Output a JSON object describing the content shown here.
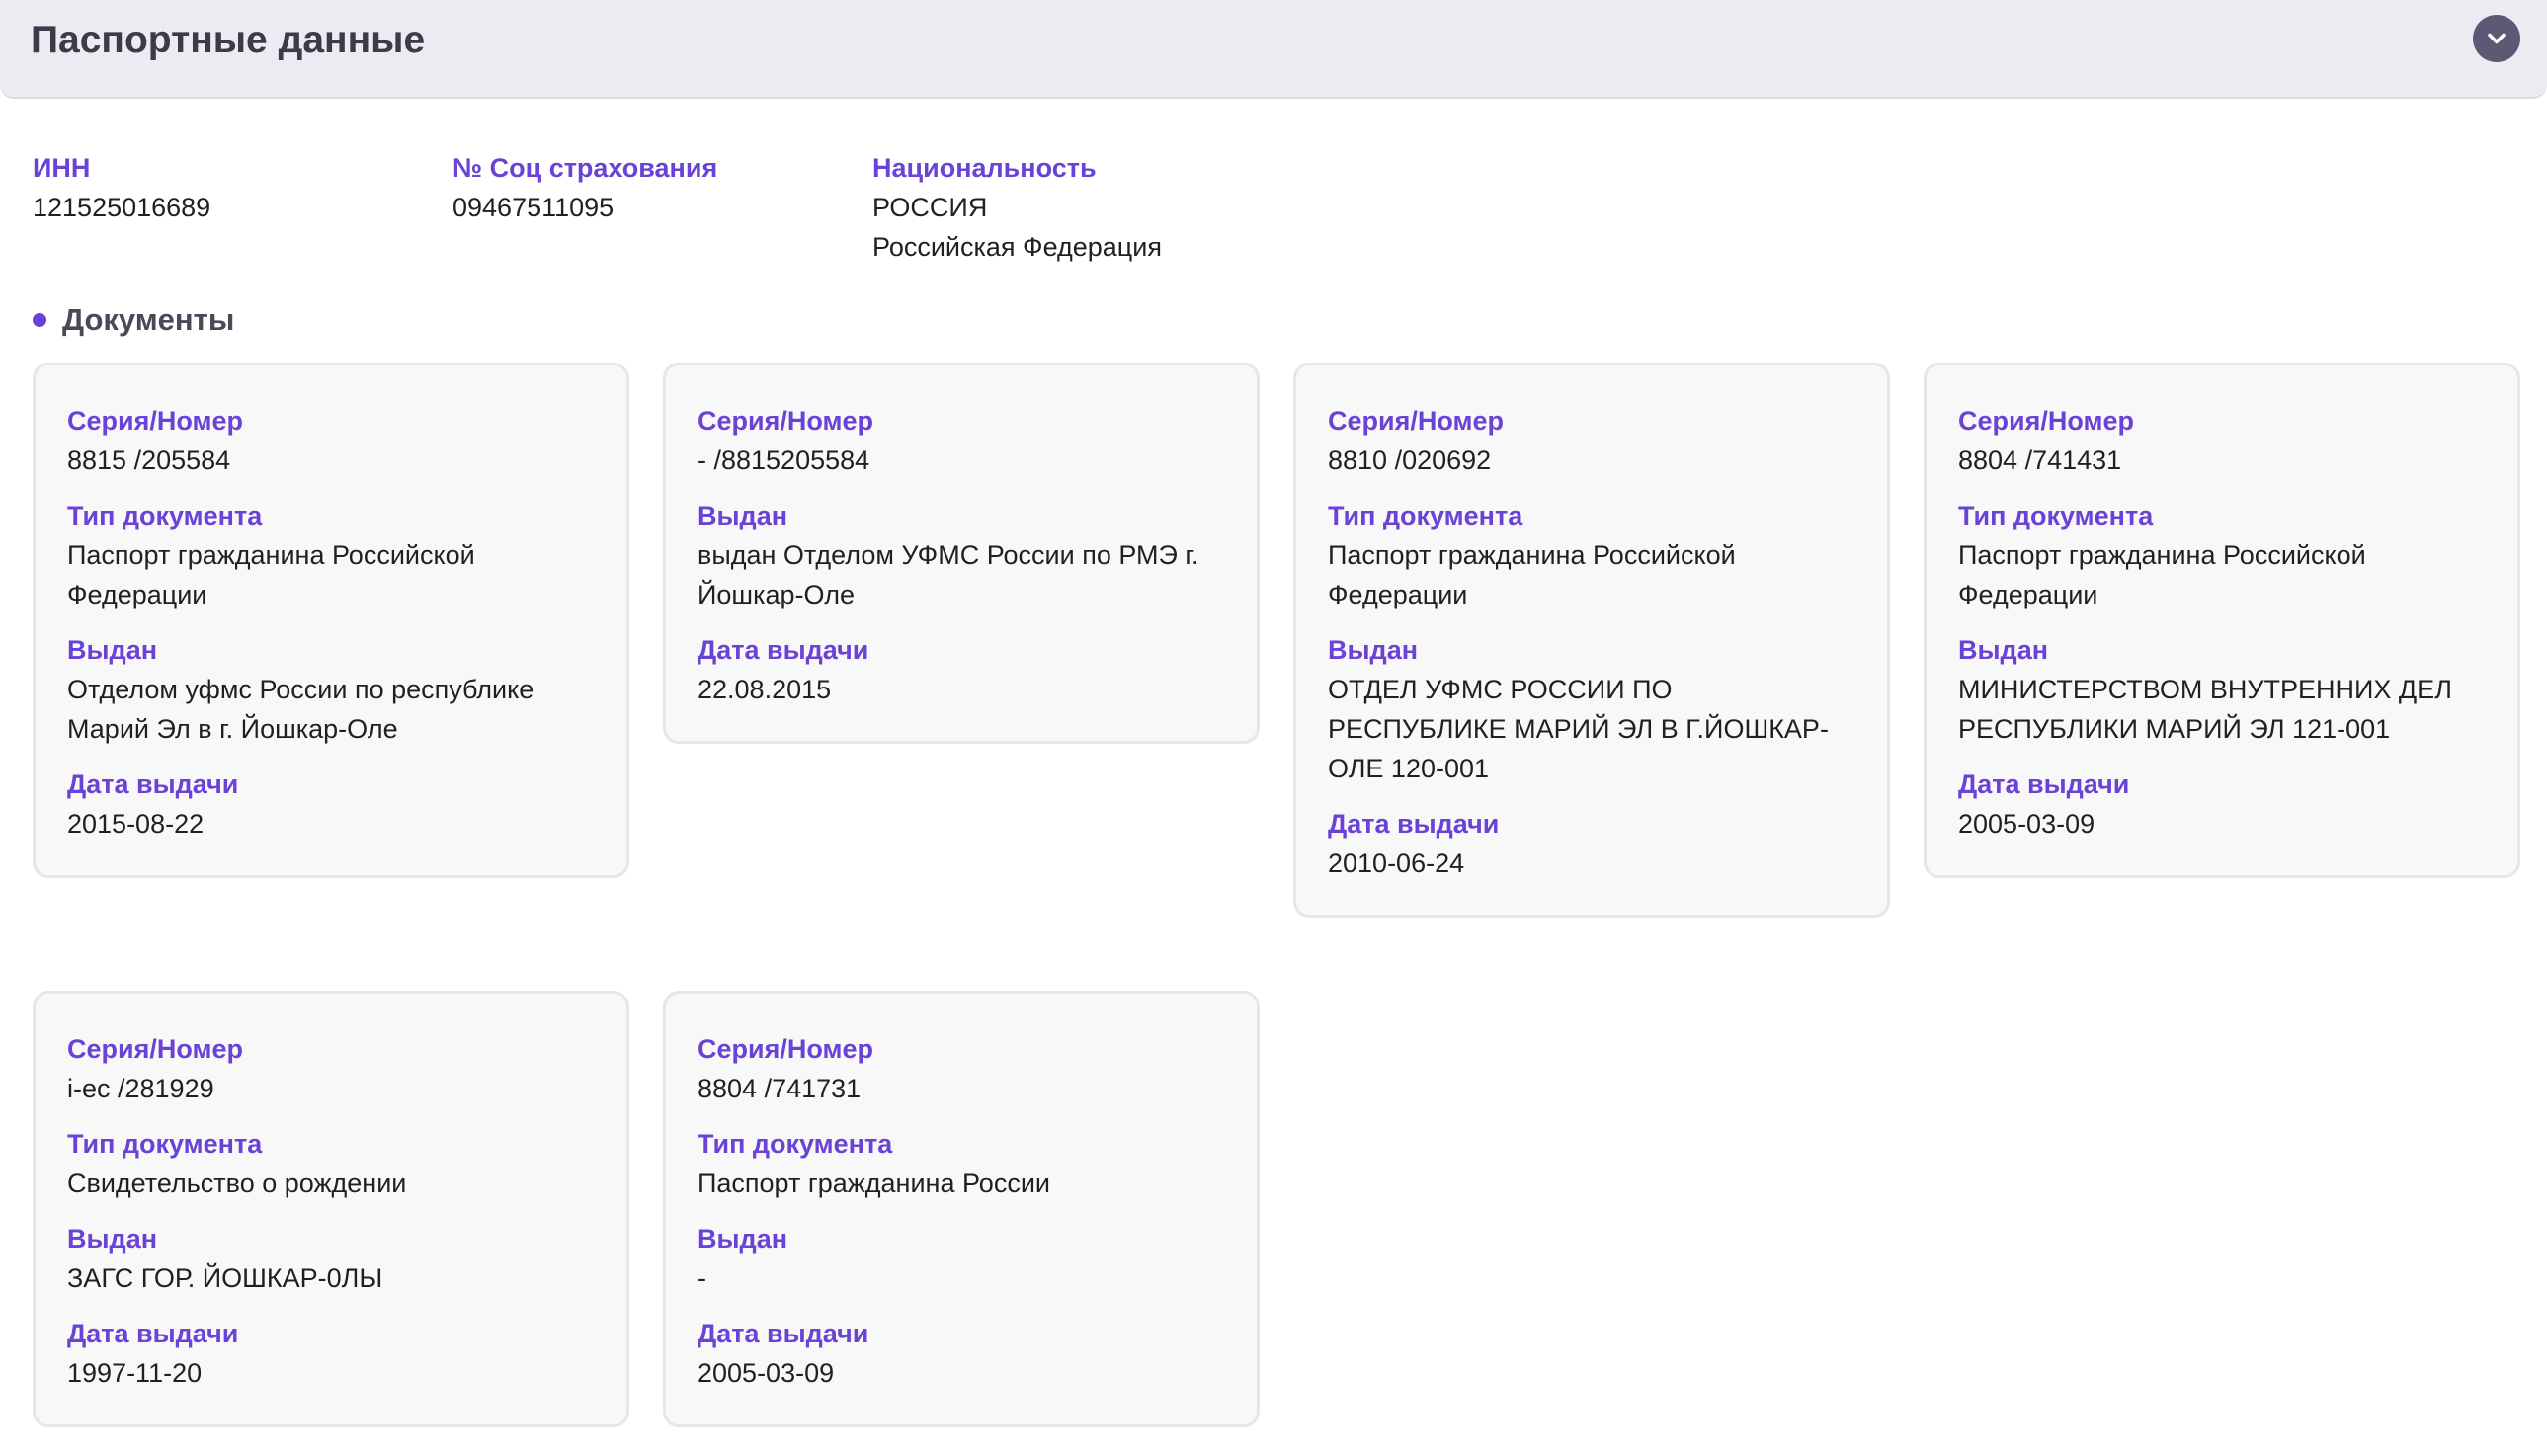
{
  "header": {
    "title": "Паспортные данные",
    "collapse_icon": "chevron-down-icon"
  },
  "summary": {
    "inn_label": "ИНН",
    "inn_value": "121525016689",
    "snils_label": "№ Соц страхования",
    "snils_value": "09467511095",
    "nationality_label": "Национальность",
    "nationality_value_1": "РОССИЯ",
    "nationality_value_2": "Российская Федерация"
  },
  "documents": {
    "title": "Документы",
    "cards": [
      {
        "series_label": "Серия/Номер",
        "series_value": "8815 /205584",
        "type_label": "Тип документа",
        "type_value": "Паспорт гражданина Российской Федерации",
        "issued_by_label": "Выдан",
        "issued_by_value": "Отделом уфмс России по республике Марий Эл в г. Йошкар-Оле",
        "date_label": "Дата выдачи",
        "date_value": "2015-08-22"
      },
      {
        "series_label": "Серия/Номер",
        "series_value": "- /8815205584",
        "issued_by_label": "Выдан",
        "issued_by_value": "выдан Отделом УФМС России по РМЭ г. Йошкар-Оле",
        "date_label": "Дата выдачи",
        "date_value": "22.08.2015"
      },
      {
        "series_label": "Серия/Номер",
        "series_value": "8810 /020692",
        "type_label": "Тип документа",
        "type_value": "Паспорт гражданина Российской Федерации",
        "issued_by_label": "Выдан",
        "issued_by_value": "ОТДЕЛ УФМС РОССИИ ПО РЕСПУБЛИКЕ МАРИЙ ЭЛ В Г.ЙОШКАР-ОЛЕ 120-001",
        "date_label": "Дата выдачи",
        "date_value": "2010-06-24"
      },
      {
        "series_label": "Серия/Номер",
        "series_value": "8804 /741431",
        "type_label": "Тип документа",
        "type_value": "Паспорт гражданина Российской Федерации",
        "issued_by_label": "Выдан",
        "issued_by_value": "МИНИСТЕРСТВОМ ВНУТРЕННИХ ДЕЛ РЕСПУБЛИКИ МАРИЙ ЭЛ 121-001",
        "date_label": "Дата выдачи",
        "date_value": "2005-03-09"
      },
      {
        "series_label": "Серия/Номер",
        "series_value": "i-ec /281929",
        "type_label": "Тип документа",
        "type_value": "Свидетельство о рождении",
        "issued_by_label": "Выдан",
        "issued_by_value": "ЗАГС ГОР. ЙОШКАР-0ЛЫ",
        "date_label": "Дата выдачи",
        "date_value": "1997-11-20"
      },
      {
        "series_label": "Серия/Номер",
        "series_value": "8804 /741731",
        "type_label": "Тип документа",
        "type_value": "Паспорт гражданина России",
        "issued_by_label": "Выдан",
        "issued_by_value": "-",
        "date_label": "Дата выдачи",
        "date_value": "2005-03-09"
      }
    ]
  },
  "colors": {
    "accent": "#6a43d6",
    "header_bg": "#ecebf1",
    "card_bg": "#f8f8f8"
  }
}
